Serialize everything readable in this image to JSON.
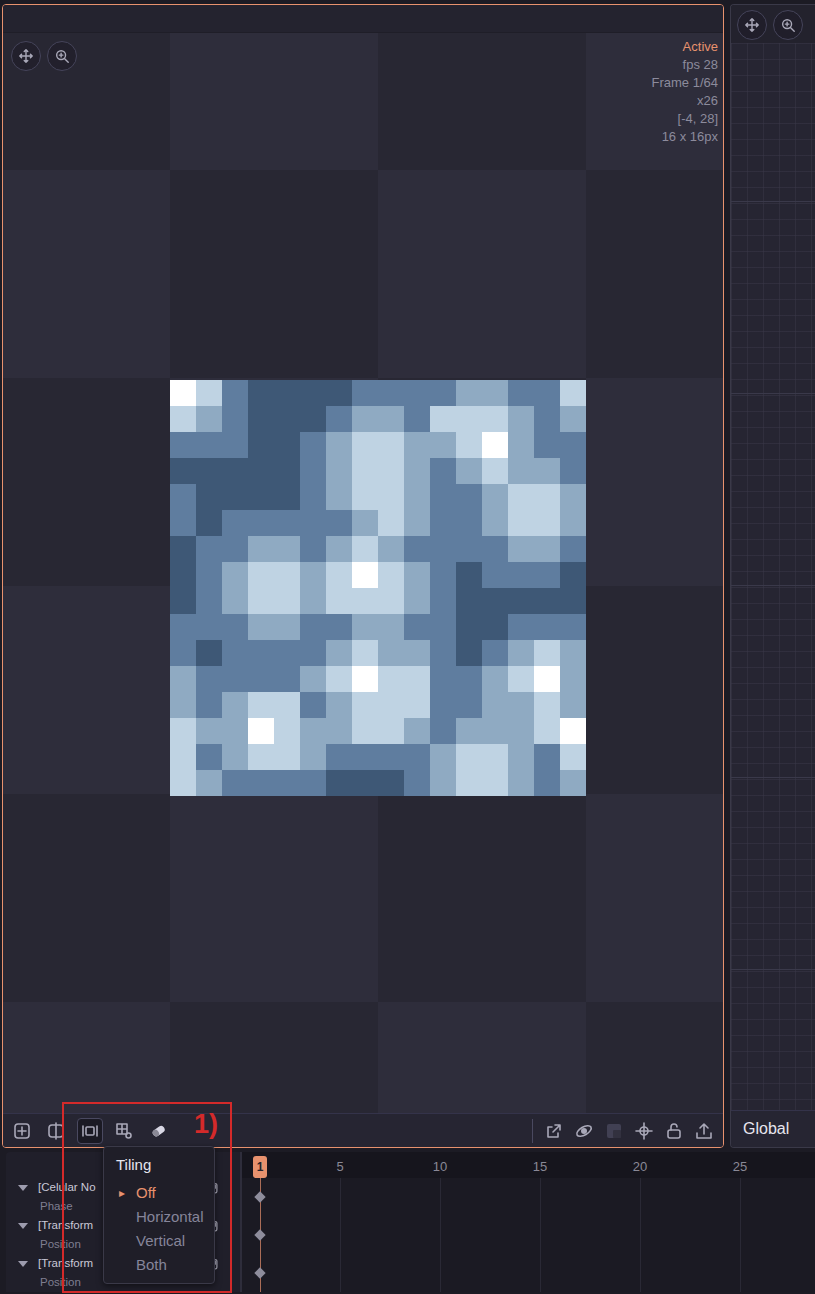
{
  "preview": {
    "status": "Active",
    "fps": "fps 28",
    "frame": "Frame 1/64",
    "zoom": "x26",
    "cursor": "[-4, 28]",
    "size": "16 x 16px",
    "palette": [
      "#3e5876",
      "#5f7d9f",
      "#8faac2",
      "#bfd3e3",
      "#ffffff"
    ],
    "pixels": [
      [
        4,
        3,
        1,
        0,
        0,
        0,
        0,
        1,
        1,
        1,
        1,
        2,
        2,
        1,
        1,
        3
      ],
      [
        3,
        2,
        1,
        0,
        0,
        0,
        1,
        2,
        2,
        1,
        3,
        3,
        3,
        2,
        1,
        2
      ],
      [
        1,
        1,
        1,
        0,
        0,
        1,
        2,
        3,
        3,
        2,
        2,
        3,
        4,
        2,
        1,
        1
      ],
      [
        0,
        0,
        0,
        0,
        0,
        1,
        2,
        3,
        3,
        2,
        1,
        2,
        3,
        2,
        2,
        1
      ],
      [
        1,
        0,
        0,
        0,
        0,
        1,
        2,
        3,
        3,
        2,
        1,
        1,
        2,
        3,
        3,
        2
      ],
      [
        1,
        0,
        1,
        1,
        1,
        1,
        1,
        2,
        3,
        2,
        1,
        1,
        2,
        3,
        3,
        2
      ],
      [
        0,
        1,
        1,
        2,
        2,
        1,
        2,
        3,
        2,
        1,
        1,
        1,
        1,
        2,
        2,
        1
      ],
      [
        0,
        1,
        2,
        3,
        3,
        2,
        3,
        4,
        3,
        2,
        1,
        0,
        1,
        1,
        1,
        0
      ],
      [
        0,
        1,
        2,
        3,
        3,
        2,
        3,
        3,
        3,
        2,
        1,
        0,
        0,
        0,
        0,
        0
      ],
      [
        1,
        1,
        1,
        2,
        2,
        1,
        1,
        2,
        2,
        1,
        1,
        0,
        0,
        1,
        1,
        1
      ],
      [
        1,
        0,
        1,
        1,
        1,
        1,
        2,
        3,
        2,
        2,
        1,
        0,
        1,
        2,
        3,
        2
      ],
      [
        2,
        1,
        1,
        1,
        1,
        2,
        3,
        4,
        3,
        3,
        1,
        1,
        2,
        3,
        4,
        2
      ],
      [
        2,
        1,
        2,
        3,
        3,
        1,
        2,
        3,
        3,
        3,
        1,
        1,
        2,
        2,
        3,
        2
      ],
      [
        3,
        2,
        2,
        4,
        3,
        2,
        2,
        3,
        3,
        2,
        1,
        2,
        2,
        2,
        3,
        4
      ],
      [
        3,
        1,
        2,
        3,
        3,
        2,
        1,
        1,
        1,
        1,
        2,
        3,
        3,
        2,
        1,
        3
      ],
      [
        3,
        2,
        1,
        1,
        1,
        1,
        0,
        0,
        0,
        1,
        2,
        3,
        3,
        2,
        1,
        2
      ]
    ]
  },
  "preview_tools_left": [
    {
      "selected": false
    },
    {
      "selected": false
    },
    {
      "selected": true
    },
    {
      "selected": false
    },
    {
      "selected": false
    }
  ],
  "preview_tools_right": [
    {
      "disabled": false
    },
    {
      "disabled": false
    },
    {
      "disabled": true
    },
    {
      "disabled": false
    },
    {
      "disabled": false
    },
    {
      "disabled": false
    }
  ],
  "tiling_menu": {
    "title": "Tiling",
    "marker": "▸",
    "items": [
      {
        "label": "Off",
        "selected": true
      },
      {
        "label": "Horizontal",
        "selected": false
      },
      {
        "label": "Vertical",
        "selected": false
      },
      {
        "label": "Both",
        "selected": false
      }
    ]
  },
  "annotation": {
    "label": "1)"
  },
  "side_panel": {
    "footer": "Global"
  },
  "timeline": {
    "current_frame": "1",
    "ticks": [
      "5",
      "10",
      "15",
      "20",
      "25"
    ],
    "rows": [
      {
        "name": "[Celular No",
        "property": "Phase",
        "keyframe": true
      },
      {
        "name": "[Transform",
        "property": "Position",
        "keyframe": true
      },
      {
        "name": "[Transform",
        "property": "Position",
        "keyframe": true
      }
    ]
  }
}
